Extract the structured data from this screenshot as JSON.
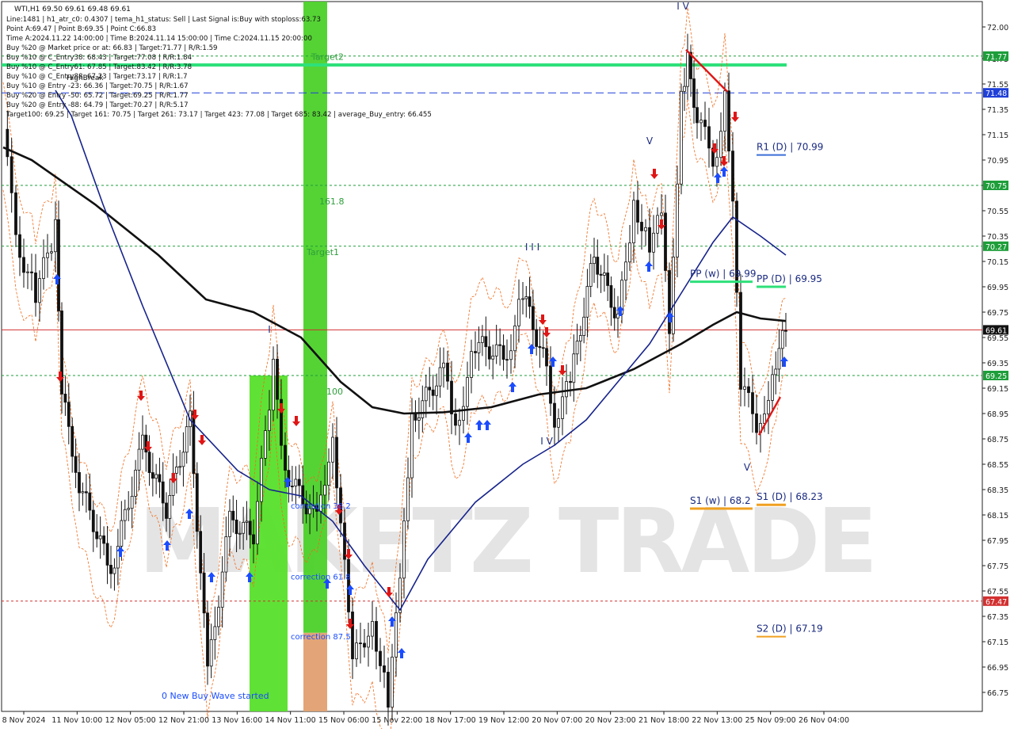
{
  "chart_data": {
    "type": "candlestick",
    "symbol": "WTI,H1",
    "ohlc_header": "69.50 69.61 69.48 69.61",
    "ylim": [
      66.6,
      72.2
    ],
    "y_ticks": [
      "72.00",
      "71.75",
      "71.55",
      "71.35",
      "71.15",
      "70.95",
      "70.75",
      "70.55",
      "70.35",
      "70.15",
      "69.95",
      "69.75",
      "69.55",
      "69.35",
      "69.15",
      "68.95",
      "68.75",
      "68.55",
      "68.35",
      "68.15",
      "67.95",
      "67.75",
      "67.55",
      "67.35",
      "67.15",
      "66.95",
      "66.75"
    ],
    "x_labels": [
      "8 Nov 2024",
      "11 Nov 10:00",
      "12 Nov 05:00",
      "12 Nov 21:00",
      "13 Nov 16:00",
      "14 Nov 11:00",
      "15 Nov 06:00",
      "15 Nov 22:00",
      "18 Nov 17:00",
      "19 Nov 12:00",
      "20 Nov 07:00",
      "20 Nov 23:00",
      "21 Nov 18:00",
      "22 Nov 13:00",
      "25 Nov 09:00",
      "26 Nov 04:00"
    ],
    "info_lines": [
      "Line:1481  |  h1_atr_c0: 0.4307  |  tema_h1_status: Sell  |  Last Signal is:Buy with stoploss:63.73",
      "Point A:69.47  |  Point B:69.35  |  Point C:66.83",
      "Time A:2024.11.22 14:00:00  |  Time B:2024.11.14 15:00:00  |  Time C:2024.11.15 20:00:00",
      "Buy %20 @ Market price or at: 66.83  |  Target:71.77  |  R/R:1.59",
      "Buy %10 @ C_Entry38: 68.43  |  Target:77.08  |  R/R:1.84",
      "Buy %10 @ C_Entry61: 67.85  |  Target:83.42  |  R/R:3.78",
      "Buy %10 @ C_Entry88: 67.23  |  Target:73.17  |  R/R:1.7",
      "Buy %10 @ Entry -23: 66.36  |  Target:70.75  |  R/R:1.67",
      "Buy %20 @ Entry -50: 65.72  |  Target:69.25  |  R/R:1.77",
      "Buy %20 @ Entry -88: 64.79  |  Target:70.27  |  R/R:5.17",
      "Target100: 69.25  |  Target 161: 70.75  |  Target 261: 73.17  |  Target 423: 77.08  |  Target 685: 83.42  |  average_Buy_entry: 66.455"
    ],
    "overlay_label": "HighBreak",
    "price_badges": [
      {
        "label": "71.77",
        "value": 71.77,
        "color": "#1e9e3a"
      },
      {
        "label": "71.48",
        "value": 71.48,
        "color": "#1f3fd8"
      },
      {
        "label": "70.75",
        "value": 70.75,
        "color": "#1e9e3a"
      },
      {
        "label": "70.27",
        "value": 70.27,
        "color": "#1e9e3a"
      },
      {
        "label": "69.61",
        "value": 69.61,
        "color": "#111111"
      },
      {
        "label": "69.25",
        "value": 69.25,
        "color": "#1e9e3a"
      },
      {
        "label": "67.47",
        "value": 67.47,
        "color": "#d23030"
      }
    ],
    "pivots": [
      {
        "label": "R1 (D) | 70.99",
        "value": 70.99,
        "color": "#3b6fd8"
      },
      {
        "label": "PP (w) | 69.99",
        "value": 69.99,
        "color": "#2ee07a"
      },
      {
        "label": "PP (D) | 69.95",
        "value": 69.95,
        "color": "#2ee07a"
      },
      {
        "label": "S1 (w) | 68.2",
        "value": 68.2,
        "color": "#f0a020"
      },
      {
        "label": "S1 (D) | 68.23",
        "value": 68.23,
        "color": "#f0a020"
      },
      {
        "label": "S2 (D) | 67.19",
        "value": 67.19,
        "color": "#f0a020"
      }
    ],
    "zone_labels": [
      "Target2",
      "161.8",
      "Target1",
      "100",
      "correction 38.2",
      "correction 61.8",
      "correction 87.5",
      "0 New Buy Wave started"
    ],
    "wave_labels": [
      "I V",
      "V",
      "I I I",
      "I V",
      "I",
      "V"
    ],
    "watermark": "MAKETZ TRADE",
    "series": [
      {
        "name": "close",
        "color": "#111111"
      },
      {
        "name": "ma_black",
        "color": "#111111"
      },
      {
        "name": "ma_blue",
        "color": "#16238c"
      }
    ]
  }
}
